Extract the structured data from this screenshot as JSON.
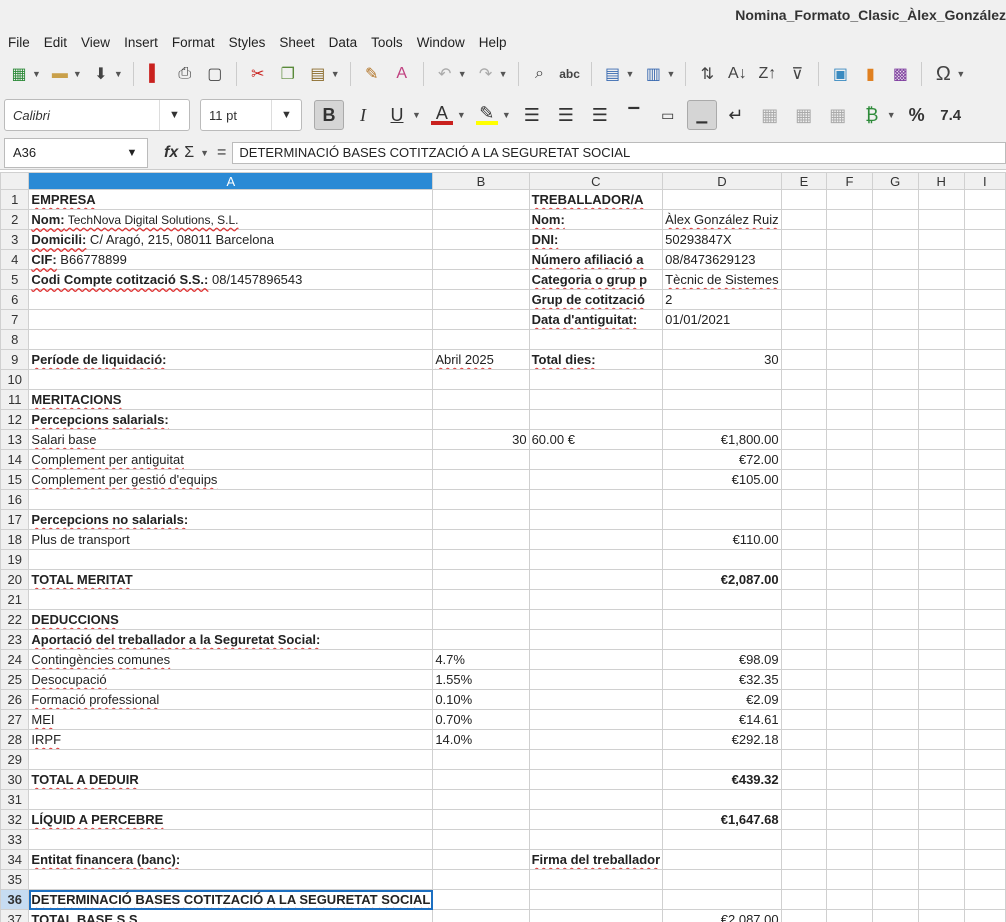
{
  "window": {
    "title": "Nomina_Formato_Clasic_Àlex_González"
  },
  "menu": [
    "File",
    "Edit",
    "View",
    "Insert",
    "Format",
    "Styles",
    "Sheet",
    "Data",
    "Tools",
    "Window",
    "Help"
  ],
  "toolbar": {
    "font_name": "Calibri",
    "font_size": "11 pt",
    "percent_label": "%",
    "decimal_label": "7.4"
  },
  "formula_bar": {
    "cell_ref": "A36",
    "fx_label": "fx",
    "sum_label": "Σ",
    "equals_label": "=",
    "content": "DETERMINACIÓ BASES COTITZACIÓ A LA SEGURETAT SOCIAL"
  },
  "columns": [
    "A",
    "B",
    "C",
    "D",
    "E",
    "F",
    "G",
    "H",
    "I"
  ],
  "rows": [
    {
      "n": "1",
      "a": "EMPRESA",
      "b": "",
      "c": "TREBALLADOR/A",
      "d": ""
    },
    {
      "n": "2",
      "a_label": "Nom:",
      "a": " TechNova Digital Solutions, S.L.",
      "c": "Nom:",
      "d": "Àlex González Ruiz"
    },
    {
      "n": "3",
      "a_label": "Domicili:",
      "a": " C/ Aragó, 215, 08011 Barcelona",
      "c": "DNI:",
      "d": "50293847X"
    },
    {
      "n": "4",
      "a_label": "CIF:",
      "a": " B66778899",
      "c": "Número afiliació a",
      "d": "08/8473629123"
    },
    {
      "n": "5",
      "a_label": "Codi Compte cotització S.S.:",
      "a": " 08/1457896543",
      "c": "Categoria o grup p",
      "d": "Tècnic de Sistemes"
    },
    {
      "n": "6",
      "a": "",
      "c": "Grup de cotització",
      "d": "2"
    },
    {
      "n": "7",
      "a": "",
      "c": "Data d'antiguitat:",
      "d": "01/01/2021"
    },
    {
      "n": "8",
      "a": ""
    },
    {
      "n": "9",
      "a": "Període de liquidació:",
      "b": "Abril 2025",
      "c": "Total dies:",
      "d": "30"
    },
    {
      "n": "10",
      "a": ""
    },
    {
      "n": "11",
      "a": "MERITACIONS"
    },
    {
      "n": "12",
      "a": "Percepcions salarials:"
    },
    {
      "n": "13",
      "a": "Salari base",
      "b": "30",
      "c": "60.00 €",
      "d": "€1,800.00"
    },
    {
      "n": "14",
      "a": "Complement per antiguitat",
      "d": "€72.00"
    },
    {
      "n": "15",
      "a": "Complement per gestió d'equips",
      "d": "€105.00"
    },
    {
      "n": "16",
      "a": ""
    },
    {
      "n": "17",
      "a": "Percepcions no salarials:"
    },
    {
      "n": "18",
      "a": "Plus de transport",
      "d": "€110.00"
    },
    {
      "n": "19",
      "a": ""
    },
    {
      "n": "20",
      "a": "TOTAL MERITAT",
      "d": "€2,087.00"
    },
    {
      "n": "21",
      "a": ""
    },
    {
      "n": "22",
      "a": "DEDUCCIONS"
    },
    {
      "n": "23",
      "a": "Aportació del treballador a la Seguretat Social:"
    },
    {
      "n": "24",
      "a": "Contingències comunes",
      "b": "4.7%",
      "d": "€98.09"
    },
    {
      "n": "25",
      "a": "Desocupació",
      "b": "1.55%",
      "d": "€32.35"
    },
    {
      "n": "26",
      "a": "Formació professional",
      "b": "0.10%",
      "d": "€2.09"
    },
    {
      "n": "27",
      "a": "MEI",
      "b": "0.70%",
      "d": "€14.61"
    },
    {
      "n": "28",
      "a": "IRPF",
      "b": "14.0%",
      "d": "€292.18"
    },
    {
      "n": "29",
      "a": ""
    },
    {
      "n": "30",
      "a": "TOTAL A DEDUIR",
      "d": "€439.32"
    },
    {
      "n": "31",
      "a": ""
    },
    {
      "n": "32",
      "a": "LÍQUID A PERCEBRE",
      "d": "€1,647.68"
    },
    {
      "n": "33",
      "a": ""
    },
    {
      "n": "34",
      "a": "Entitat financera (banc):",
      "c": "Firma del treballador"
    },
    {
      "n": "35",
      "a": ""
    },
    {
      "n": "36",
      "a": "DETERMINACIÓ BASES COTITZACIÓ A LA SEGURETAT SOCIAL"
    },
    {
      "n": "37",
      "a": "TOTAL BASE S.S.",
      "d": "€2,087.00"
    }
  ]
}
